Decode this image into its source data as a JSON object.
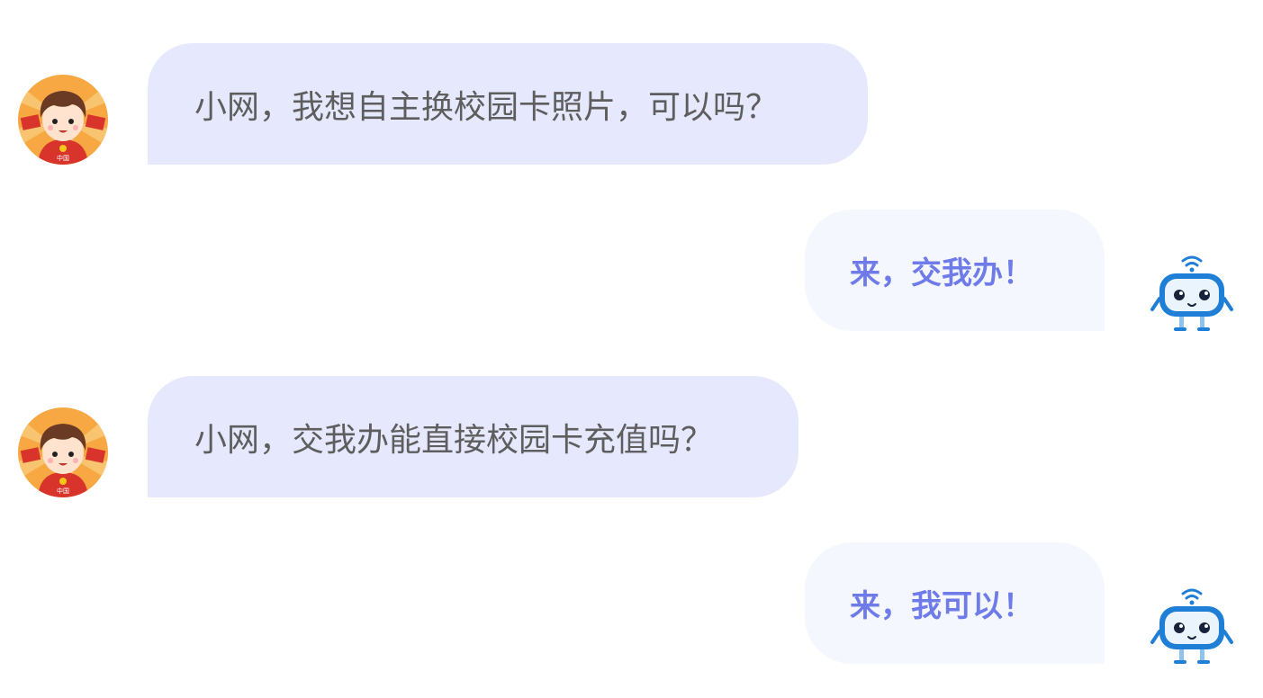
{
  "conversation": {
    "messages": [
      {
        "sender": "user",
        "text": "小网，我想自主换校园卡照片，可以吗？"
      },
      {
        "sender": "bot",
        "text": "来，交我办！"
      },
      {
        "sender": "user",
        "text": "小网，交我办能直接校园卡充值吗？"
      },
      {
        "sender": "bot",
        "text": "来，我可以！"
      }
    ]
  },
  "avatar_badge_text": "中国",
  "colors": {
    "user_bubble": "#e6e9fd",
    "bot_bubble": "#f5f7fe",
    "user_text": "#5e5e5e",
    "bot_text": "#6e7be9",
    "robot_blue": "#1f7fd6"
  },
  "icons": {
    "user_avatar": "boy-with-flags-avatar-icon",
    "bot_avatar": "robot-wifi-avatar-icon"
  }
}
